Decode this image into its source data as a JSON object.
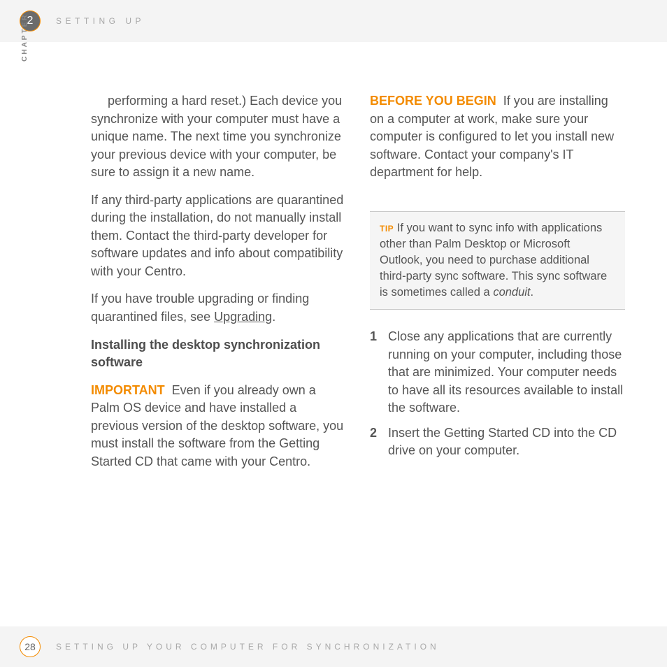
{
  "header": {
    "chapter_number": "2",
    "title": "SETTING UP",
    "chapter_label": "CHAPTER"
  },
  "col1": {
    "p1": "performing a hard reset.) Each device you synchronize with your computer must have a unique name. The next time you synchronize your previous device with your computer, be sure to assign it a new name.",
    "p2": "If any third-party applications are quarantined during the installation, do not manually install them. Contact the third-party developer for software updates and info about compatibility with your Centro.",
    "p3_pre": "If you have trouble upgrading or finding quarantined files, see ",
    "p3_link": "Upgrading",
    "p3_post": ".",
    "heading": "Installing the desktop synchronization software",
    "important_label": "IMPORTANT",
    "important_text": "Even if you already own a Palm OS device and have installed a previous version of the desktop software, you must install the software from the Getting Started CD that came with your Centro."
  },
  "col2": {
    "before_label": "BEFORE YOU BEGIN",
    "before_text": "If you are installing on a computer at work, make sure your computer is configured to let you install new software. Contact your company's IT department for help.",
    "tip_label": "TIP",
    "tip_text_pre": "If you want to sync info with applications other than Palm Desktop or Microsoft Outlook, you need to purchase additional third-party sync software. This sync software is sometimes called a ",
    "tip_italic": "conduit",
    "tip_text_post": ".",
    "steps": [
      {
        "num": "1",
        "text": "Close any applications that are currently running on your computer, including those that are minimized. Your computer needs to have all its resources available to install the software."
      },
      {
        "num": "2",
        "text": "Insert the Getting Started CD into the CD drive on your computer."
      }
    ]
  },
  "footer": {
    "page_number": "28",
    "title": "SETTING UP YOUR COMPUTER FOR SYNCHRONIZATION"
  }
}
